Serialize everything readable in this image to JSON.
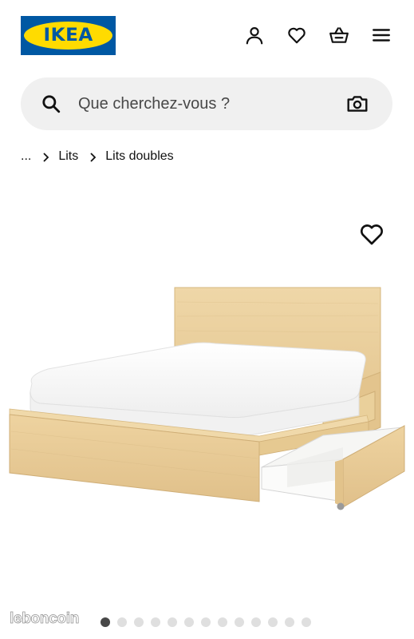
{
  "header": {
    "logo_text": "IKEA",
    "icons": {
      "account": "person-icon",
      "wishlist": "heart-icon",
      "cart": "basket-icon",
      "menu": "hamburger-menu-icon"
    }
  },
  "search": {
    "placeholder": "Que cherchez-vous ?",
    "icon": "search-icon",
    "camera_icon": "camera-icon"
  },
  "breadcrumb": {
    "items": [
      "...",
      "Lits",
      "Lits doubles"
    ]
  },
  "product": {
    "favorite_icon": "heart-outline-icon",
    "image_description_icon": "bed-image"
  },
  "carousel": {
    "total": 13,
    "active_index": 0
  },
  "watermark": {
    "text": "leboncoin"
  },
  "colors": {
    "ikea_blue": "#0058a3",
    "ikea_yellow": "#ffdb00",
    "search_bg": "#f0f0f0",
    "dot_active": "#484848",
    "dot_inactive": "#dfdfdf"
  }
}
